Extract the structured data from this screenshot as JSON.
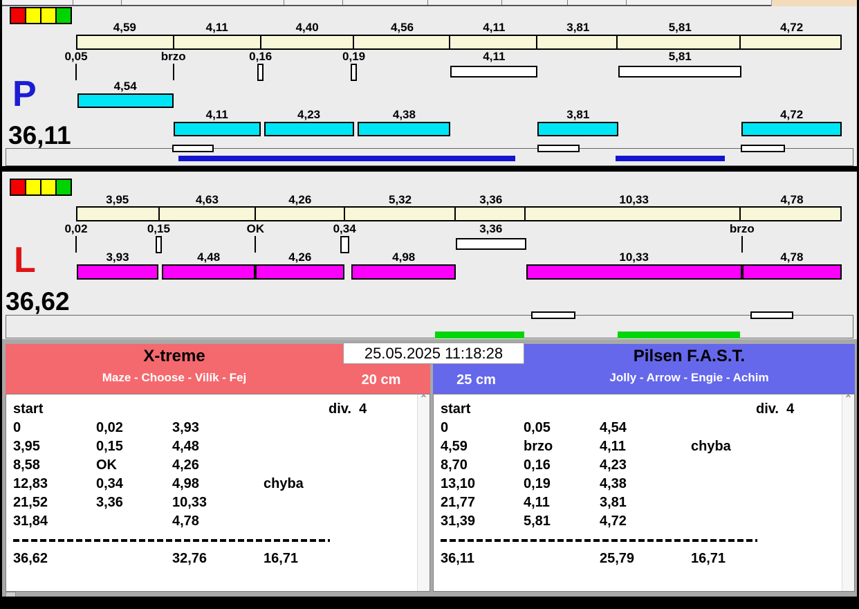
{
  "clock": "25.05.2025 11:18:28",
  "tracks": [
    {
      "id": "P",
      "letter": "P",
      "letter_color": "#1c1cd2",
      "total_label": "36,11",
      "total_seconds": 36.11,
      "lights": [
        "#f50000",
        "#ffff00",
        "#ffff00",
        "#00d400"
      ],
      "bar_color": "#f8f8d8",
      "run_color": "#00e5f5",
      "sub_bar_color": "#1414d0",
      "segments": [
        {
          "label": "4,59",
          "seconds": 4.59
        },
        {
          "label": "4,11",
          "seconds": 4.11
        },
        {
          "label": "4,40",
          "seconds": 4.4
        },
        {
          "label": "4,56",
          "seconds": 4.56
        },
        {
          "label": "4,11",
          "seconds": 4.11
        },
        {
          "label": "3,81",
          "seconds": 3.81
        },
        {
          "label": "5,81",
          "seconds": 5.81
        },
        {
          "label": "4,72",
          "seconds": 4.72
        }
      ],
      "markers": [
        {
          "label": "0,05",
          "type": "tick",
          "t": 0
        },
        {
          "label": "brzo",
          "type": "tick",
          "t": 4.59
        },
        {
          "label": "0,16",
          "type": "box_small",
          "t": 8.7
        },
        {
          "label": "0,19",
          "type": "box_small",
          "t": 13.1
        },
        {
          "label": "4,11",
          "type": "box_wide",
          "t": 17.66,
          "dur": 4.11
        },
        {
          "label": "5,81",
          "type": "box_wide",
          "t": 25.58,
          "dur": 5.81
        }
      ],
      "runs": [
        {
          "label": "4,54",
          "t0": 0.05,
          "t1": 4.59,
          "row": 0
        },
        {
          "label": "4,11",
          "t0": 4.59,
          "t1": 8.7,
          "row": 1
        },
        {
          "label": "4,23",
          "t0": 8.86,
          "t1": 13.1,
          "row": 1
        },
        {
          "label": "4,38",
          "t0": 13.29,
          "t1": 17.66,
          "row": 1
        },
        {
          "label": "3,81",
          "t0": 21.77,
          "t1": 25.58,
          "row": 1
        },
        {
          "label": "4,72",
          "t0": 31.39,
          "t1": 36.11,
          "row": 1
        }
      ],
      "sub_boxes": [
        {
          "t0": 4.53,
          "t1": 6.49
        },
        {
          "t0": 21.76,
          "t1": 23.75
        },
        {
          "t0": 31.35,
          "t1": 33.43
        }
      ],
      "sub_bars": [
        {
          "t0": 4.83,
          "t1": 20.71
        },
        {
          "t0": 25.44,
          "t1": 30.6
        }
      ]
    },
    {
      "id": "L",
      "letter": "L",
      "letter_color": "#e01414",
      "total_label": "36,62",
      "total_seconds": 36.62,
      "lights": [
        "#f50000",
        "#ffff00",
        "#ffff00",
        "#00d400"
      ],
      "bar_color": "#f8f8d8",
      "run_color": "#fb00fb",
      "sub_bar_color": "#00d60b",
      "segments": [
        {
          "label": "3,95",
          "seconds": 3.95
        },
        {
          "label": "4,63",
          "seconds": 4.63
        },
        {
          "label": "4,26",
          "seconds": 4.26
        },
        {
          "label": "5,32",
          "seconds": 5.32
        },
        {
          "label": "3,36",
          "seconds": 3.36
        },
        {
          "label": "10,33",
          "seconds": 10.33
        },
        {
          "label": "4,78",
          "seconds": 4.78
        }
      ],
      "markers": [
        {
          "label": "0,02",
          "type": "tick",
          "t": 0
        },
        {
          "label": "0,15",
          "type": "box_small",
          "t": 3.95
        },
        {
          "label": "OK",
          "type": "tick",
          "t": 8.58
        },
        {
          "label": "0,34",
          "type": "box_small",
          "t": 12.84,
          "w": 13
        },
        {
          "label": "3,36",
          "type": "box_wide",
          "t": 18.16,
          "dur": 3.36
        },
        {
          "label": "brzo",
          "type": "tick",
          "t": 31.85
        }
      ],
      "runs": [
        {
          "label": "3,93",
          "t0": 0.02,
          "t1": 3.95,
          "row": 0
        },
        {
          "label": "4,48",
          "t0": 4.1,
          "t1": 8.58,
          "row": 0
        },
        {
          "label": "4,26",
          "t0": 8.58,
          "t1": 12.84,
          "row": 0
        },
        {
          "label": "4,98",
          "t0": 13.18,
          "t1": 18.16,
          "row": 0
        },
        {
          "label": "10,33",
          "t0": 21.52,
          "t1": 31.85,
          "row": 0
        },
        {
          "label": "4,78",
          "t0": 31.85,
          "t1": 36.62,
          "row": 0
        }
      ],
      "sub_boxes": [
        {
          "t0": 21.76,
          "t1": 23.88
        },
        {
          "t0": 32.25,
          "t1": 34.3
        }
      ],
      "sub_bars": [
        {
          "t0": 17.17,
          "t1": 21.44
        },
        {
          "t0": 25.9,
          "t1": 31.76
        }
      ]
    }
  ],
  "teams": [
    {
      "name": "X-treme",
      "members": "Maze - Choose - Vilík - Fej",
      "distance": "20 cm",
      "color": "#f4696e",
      "table": {
        "header_left": "start",
        "header_right": "div.  4",
        "rows": [
          [
            "0",
            "0,02",
            "3,93",
            ""
          ],
          [
            "3,95",
            "0,15",
            "4,48",
            ""
          ],
          [
            "8,58",
            "OK",
            "4,26",
            ""
          ],
          [
            "12,83",
            "0,34",
            "4,98",
            "chyba"
          ],
          [
            "21,52",
            "3,36",
            "10,33",
            ""
          ],
          [
            "31,84",
            "",
            "4,78",
            ""
          ]
        ],
        "totals": [
          "36,62",
          "",
          "32,76",
          "16,71"
        ]
      }
    },
    {
      "name": "Pilsen F.A.S.T.",
      "members": "Jolly - Arrow - Engie - Achim",
      "distance": "25 cm",
      "color": "#6568ea",
      "table": {
        "header_left": "start",
        "header_right": "div.  4",
        "rows": [
          [
            "0",
            "0,05",
            "4,54",
            ""
          ],
          [
            "4,59",
            "brzo",
            "4,11",
            "chyba"
          ],
          [
            "8,70",
            "0,16",
            "4,23",
            ""
          ],
          [
            "13,10",
            "0,19",
            "4,38",
            ""
          ],
          [
            "21,77",
            "4,11",
            "3,81",
            ""
          ],
          [
            "31,39",
            "5,81",
            "4,72",
            ""
          ]
        ],
        "totals": [
          "36,11",
          "",
          "25,79",
          "16,71"
        ]
      }
    }
  ]
}
